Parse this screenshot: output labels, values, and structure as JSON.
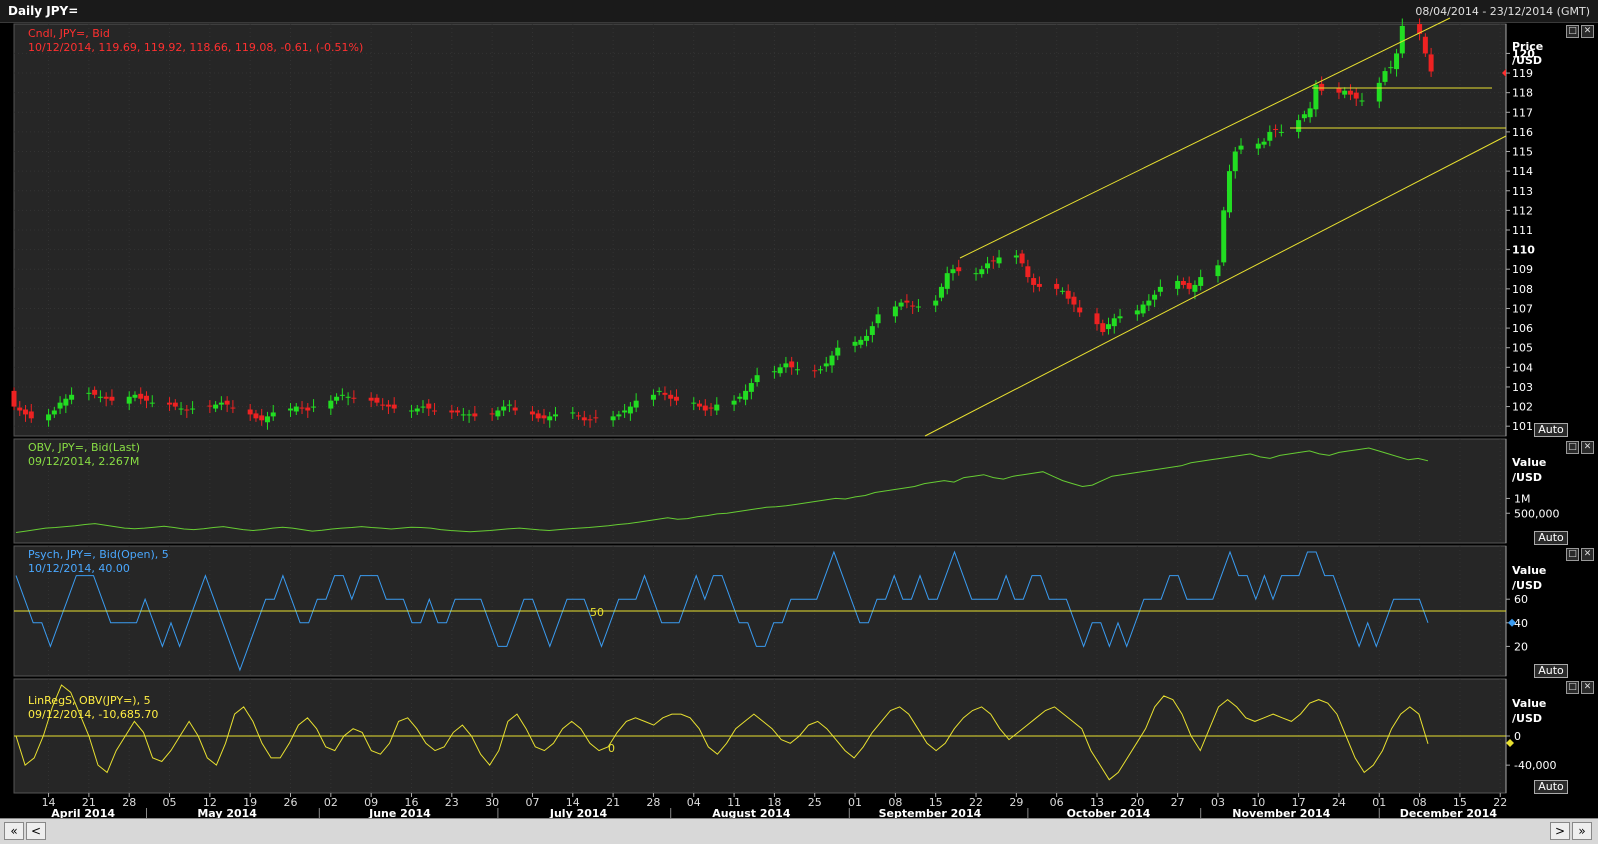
{
  "window": {
    "title": "Daily JPY=",
    "date_range": "08/04/2014 - 23/12/2014 (GMT)"
  },
  "panes": {
    "price": {
      "legend": "Cndl, JPY=, Bid",
      "values": "10/12/2014, 119.69, 119.92, 118.66, 119.08, -0.61, (-0.51%)",
      "axis_title_1": "Price",
      "axis_title_2": "/USD",
      "auto": "Auto"
    },
    "obv": {
      "legend": "OBV, JPY=, Bid(Last)",
      "values": "09/12/2014, 2.267M",
      "axis_title_1": "Value",
      "axis_title_2": "/USD",
      "auto": "Auto"
    },
    "psych": {
      "legend": "Psych, JPY=, Bid(Open),  5",
      "values": "10/12/2014, 40.00",
      "axis_title_1": "Value",
      "axis_title_2": "/USD",
      "auto": "Auto",
      "line_label": "50"
    },
    "linreg": {
      "legend": "LinRegS, OBV(JPY=),  5",
      "values": "09/12/2014, -10,685.70",
      "axis_title_1": "Value",
      "axis_title_2": "/USD",
      "auto": "Auto",
      "line_label": "0"
    }
  },
  "colors": {
    "up": "#22dd22",
    "down": "#ee2222",
    "obv": "#66cc33",
    "psych": "#3a9bf0",
    "linreg": "#e8e030",
    "trend": "#e8e030",
    "legend_price": "#ff3030",
    "legend_obv": "#88dd44",
    "legend_psych": "#4aa8ff",
    "legend_linreg": "#ffee44"
  },
  "chart_data": [
    {
      "type": "candlestick",
      "x_range": [
        "2014-04-08",
        "2014-12-23"
      ],
      "ylim": [
        100.5,
        121.5
      ],
      "yticks": [
        "101",
        "102",
        "103",
        "104",
        "105",
        "106",
        "107",
        "108",
        "109",
        "110",
        "111",
        "112",
        "113",
        "114",
        "115",
        "116",
        "117",
        "118",
        "119",
        "120"
      ],
      "last_marker": 119,
      "close": [
        102.0,
        101.8,
        101.6,
        101.4,
        101.6,
        101.8,
        102.2,
        102.4,
        102.6,
        102.7,
        102.6,
        102.5,
        102.4,
        102.3,
        102.5,
        102.6,
        102.4,
        102.3,
        102.2,
        102.1,
        102.0,
        101.9,
        101.8,
        101.9,
        102.0,
        102.1,
        102.2,
        102.1,
        101.9,
        101.6,
        101.4,
        101.3,
        101.5,
        101.7,
        101.9,
        102.0,
        101.9,
        101.8,
        102.0,
        102.3,
        102.5,
        102.6,
        102.5,
        102.4,
        102.3,
        102.2,
        102.1,
        102.0,
        101.9,
        101.8,
        101.9,
        102.0,
        101.9,
        101.8,
        101.7,
        101.7,
        101.6,
        101.6,
        101.5,
        101.6,
        101.8,
        102.0,
        102.1,
        101.8,
        101.6,
        101.4,
        101.4,
        101.5,
        101.6,
        101.7,
        101.5,
        101.3,
        101.3,
        101.4,
        101.5,
        101.6,
        101.8,
        102.0,
        102.3,
        102.6,
        102.8,
        102.6,
        102.4,
        102.3,
        102.2,
        102.0,
        101.8,
        101.9,
        102.1,
        102.3,
        102.5,
        102.8,
        103.2,
        103.6,
        103.8,
        104.0,
        104.2,
        104.0,
        103.9,
        103.8,
        103.9,
        104.2,
        104.6,
        105.0,
        105.3,
        105.4,
        105.6,
        106.1,
        106.7,
        107.1,
        107.3,
        107.3,
        107.1,
        107.1,
        107.4,
        108.1,
        108.8,
        109.0,
        108.9,
        108.8,
        109.0,
        109.3,
        109.4,
        109.6,
        109.7,
        109.3,
        108.6,
        108.2,
        108.1,
        108.0,
        107.9,
        107.5,
        107.2,
        106.8,
        106.2,
        105.8,
        106.2,
        106.5,
        106.6,
        106.9,
        107.2,
        107.4,
        107.7,
        108.1,
        108.4,
        108.2,
        108.0,
        108.2,
        108.6,
        109.2,
        112.0,
        114.0,
        115.0,
        115.3,
        115.4,
        115.5,
        116.0,
        116.1,
        116.0,
        116.6,
        116.9,
        117.2,
        118.4,
        118.1,
        118.0,
        118.1,
        117.9,
        117.7,
        117.6,
        118.5,
        119.1,
        119.3,
        120.0,
        121.4,
        121.0,
        120.0,
        119.08
      ],
      "panel": "price"
    },
    {
      "type": "line",
      "series": [
        {
          "name": "OBV",
          "values": [
            -0.15,
            -0.1,
            -0.05,
            0.0,
            0.02,
            0.05,
            0.08,
            0.12,
            0.15,
            0.1,
            0.05,
            0.0,
            -0.02,
            0.0,
            0.03,
            0.06,
            0.02,
            -0.03,
            -0.05,
            -0.02,
            0.02,
            0.05,
            0.0,
            -0.05,
            -0.08,
            -0.05,
            0.0,
            0.03,
            0.0,
            -0.05,
            -0.1,
            -0.07,
            -0.03,
            0.0,
            0.02,
            0.05,
            0.02,
            0.0,
            -0.03,
            0.0,
            0.03,
            0.02,
            0.0,
            -0.05,
            -0.08,
            -0.1,
            -0.12,
            -0.1,
            -0.08,
            -0.05,
            -0.02,
            0.0,
            -0.03,
            -0.06,
            -0.08,
            -0.05,
            -0.02,
            0.0,
            0.02,
            0.05,
            0.08,
            0.12,
            0.15,
            0.2,
            0.25,
            0.3,
            0.35,
            0.3,
            0.32,
            0.38,
            0.42,
            0.48,
            0.5,
            0.55,
            0.6,
            0.65,
            0.7,
            0.72,
            0.75,
            0.8,
            0.85,
            0.9,
            0.95,
            1.0,
            0.98,
            1.05,
            1.1,
            1.2,
            1.25,
            1.3,
            1.35,
            1.4,
            1.5,
            1.55,
            1.6,
            1.55,
            1.7,
            1.75,
            1.8,
            1.7,
            1.65,
            1.75,
            1.8,
            1.85,
            1.9,
            1.75,
            1.6,
            1.5,
            1.4,
            1.45,
            1.6,
            1.75,
            1.8,
            1.85,
            1.9,
            1.95,
            2.0,
            2.05,
            2.1,
            2.2,
            2.25,
            2.3,
            2.35,
            2.4,
            2.45,
            2.5,
            2.4,
            2.35,
            2.45,
            2.5,
            2.55,
            2.6,
            2.5,
            2.45,
            2.55,
            2.6,
            2.65,
            2.7,
            2.6,
            2.5,
            2.4,
            2.3,
            2.35,
            2.267
          ]
        }
      ],
      "yticks": [
        "1M",
        "500,000"
      ],
      "panel": "obv"
    },
    {
      "type": "line",
      "series": [
        {
          "name": "Psych",
          "values": [
            80,
            60,
            40,
            40,
            20,
            40,
            60,
            80,
            80,
            80,
            60,
            40,
            40,
            40,
            40,
            60,
            40,
            20,
            40,
            20,
            40,
            60,
            80,
            60,
            40,
            20,
            0,
            20,
            40,
            60,
            60,
            80,
            60,
            40,
            40,
            60,
            60,
            80,
            80,
            60,
            80,
            80,
            80,
            60,
            60,
            60,
            40,
            40,
            60,
            40,
            40,
            60,
            60,
            60,
            60,
            40,
            20,
            20,
            40,
            60,
            60,
            40,
            20,
            40,
            60,
            60,
            60,
            40,
            20,
            40,
            60,
            60,
            60,
            80,
            60,
            40,
            40,
            40,
            60,
            80,
            60,
            80,
            80,
            60,
            40,
            40,
            20,
            20,
            40,
            40,
            60,
            60,
            60,
            60,
            80,
            100,
            80,
            60,
            40,
            40,
            60,
            60,
            80,
            60,
            60,
            80,
            60,
            60,
            80,
            100,
            80,
            60,
            60,
            60,
            60,
            80,
            60,
            60,
            80,
            80,
            60,
            60,
            60,
            40,
            20,
            40,
            40,
            20,
            40,
            20,
            40,
            60,
            60,
            60,
            80,
            80,
            60,
            60,
            60,
            60,
            80,
            100,
            80,
            80,
            60,
            80,
            60,
            80,
            80,
            80,
            100,
            100,
            80,
            80,
            60,
            40,
            20,
            40,
            20,
            40,
            60,
            60,
            60,
            60,
            40
          ]
        }
      ],
      "yticks": [
        "60",
        "40",
        "20"
      ],
      "last_marker": 40,
      "reference_line": 50,
      "panel": "psych"
    },
    {
      "type": "line",
      "series": [
        {
          "name": "LinRegS",
          "values": [
            0,
            -40000,
            -30000,
            0,
            40000,
            70000,
            60000,
            30000,
            0,
            -40000,
            -50000,
            -20000,
            0,
            20000,
            5000,
            -30000,
            -35000,
            -20000,
            0,
            20000,
            0,
            -30000,
            -40000,
            -10000,
            30000,
            40000,
            20000,
            -10000,
            -30000,
            -30000,
            -10000,
            15000,
            25000,
            10000,
            -15000,
            -20000,
            0,
            10000,
            5000,
            -20000,
            -25000,
            -10000,
            20000,
            25000,
            10000,
            -10000,
            -20000,
            -15000,
            5000,
            15000,
            0,
            -25000,
            -40000,
            -20000,
            20000,
            30000,
            10000,
            -15000,
            -20000,
            -10000,
            10000,
            20000,
            10000,
            -10000,
            -20000,
            -15000,
            5000,
            20000,
            25000,
            20000,
            15000,
            25000,
            30000,
            30000,
            25000,
            10000,
            -15000,
            -25000,
            -10000,
            10000,
            20000,
            30000,
            20000,
            10000,
            -5000,
            -10000,
            0,
            15000,
            20000,
            10000,
            -5000,
            -20000,
            -30000,
            -15000,
            5000,
            20000,
            35000,
            40000,
            30000,
            10000,
            -10000,
            -20000,
            -10000,
            10000,
            25000,
            35000,
            40000,
            30000,
            10000,
            -5000,
            5000,
            15000,
            25000,
            35000,
            40000,
            30000,
            20000,
            10000,
            -20000,
            -40000,
            -60000,
            -50000,
            -30000,
            -10000,
            10000,
            40000,
            55000,
            50000,
            30000,
            0,
            -20000,
            10000,
            40000,
            50000,
            40000,
            25000,
            20000,
            25000,
            30000,
            25000,
            20000,
            30000,
            45000,
            50000,
            45000,
            30000,
            0,
            -30000,
            -50000,
            -40000,
            -20000,
            10000,
            30000,
            40000,
            30000,
            -10685.7
          ]
        }
      ],
      "yticks": [
        "0",
        "-40,000"
      ],
      "last_marker": 0,
      "reference_line": 0,
      "panel": "linreg"
    }
  ],
  "x_axis": {
    "days": [
      {
        "t": "14",
        "d": 6
      },
      {
        "t": "21",
        "d": 13
      },
      {
        "t": "28",
        "d": 20
      },
      {
        "t": "05",
        "d": 27
      },
      {
        "t": "12",
        "d": 34
      },
      {
        "t": "19",
        "d": 41
      },
      {
        "t": "26",
        "d": 48
      },
      {
        "t": "02",
        "d": 55
      },
      {
        "t": "09",
        "d": 62
      },
      {
        "t": "16",
        "d": 69
      },
      {
        "t": "23",
        "d": 76
      },
      {
        "t": "30",
        "d": 83
      },
      {
        "t": "07",
        "d": 90
      },
      {
        "t": "14",
        "d": 97
      },
      {
        "t": "21",
        "d": 104
      },
      {
        "t": "28",
        "d": 111
      },
      {
        "t": "04",
        "d": 118
      },
      {
        "t": "11",
        "d": 125
      },
      {
        "t": "18",
        "d": 132
      },
      {
        "t": "25",
        "d": 139
      },
      {
        "t": "01",
        "d": 146
      },
      {
        "t": "08",
        "d": 153
      },
      {
        "t": "15",
        "d": 160
      },
      {
        "t": "22",
        "d": 167
      },
      {
        "t": "29",
        "d": 174
      },
      {
        "t": "06",
        "d": 181
      },
      {
        "t": "13",
        "d": 188
      },
      {
        "t": "20",
        "d": 195
      },
      {
        "t": "27",
        "d": 202
      },
      {
        "t": "03",
        "d": 209
      },
      {
        "t": "10",
        "d": 216
      },
      {
        "t": "17",
        "d": 223
      },
      {
        "t": "24",
        "d": 230
      },
      {
        "t": "01",
        "d": 237
      },
      {
        "t": "08",
        "d": 244
      },
      {
        "t": "15",
        "d": 251
      },
      {
        "t": "22",
        "d": 258
      }
    ],
    "months": [
      {
        "t": "April 2014",
        "d": 12
      },
      {
        "t": "May 2014",
        "d": 37
      },
      {
        "t": "June 2014",
        "d": 67
      },
      {
        "t": "July 2014",
        "d": 98
      },
      {
        "t": "August 2014",
        "d": 128
      },
      {
        "t": "September 2014",
        "d": 159
      },
      {
        "t": "October 2014",
        "d": 190
      },
      {
        "t": "November 2014",
        "d": 220
      },
      {
        "t": "December 2014",
        "d": 249
      }
    ],
    "month_separators": [
      23,
      53,
      84,
      114,
      145,
      176,
      206,
      237
    ]
  },
  "scroll": {
    "left": "«",
    "prev": "<",
    "next": ">",
    "right": "»"
  }
}
